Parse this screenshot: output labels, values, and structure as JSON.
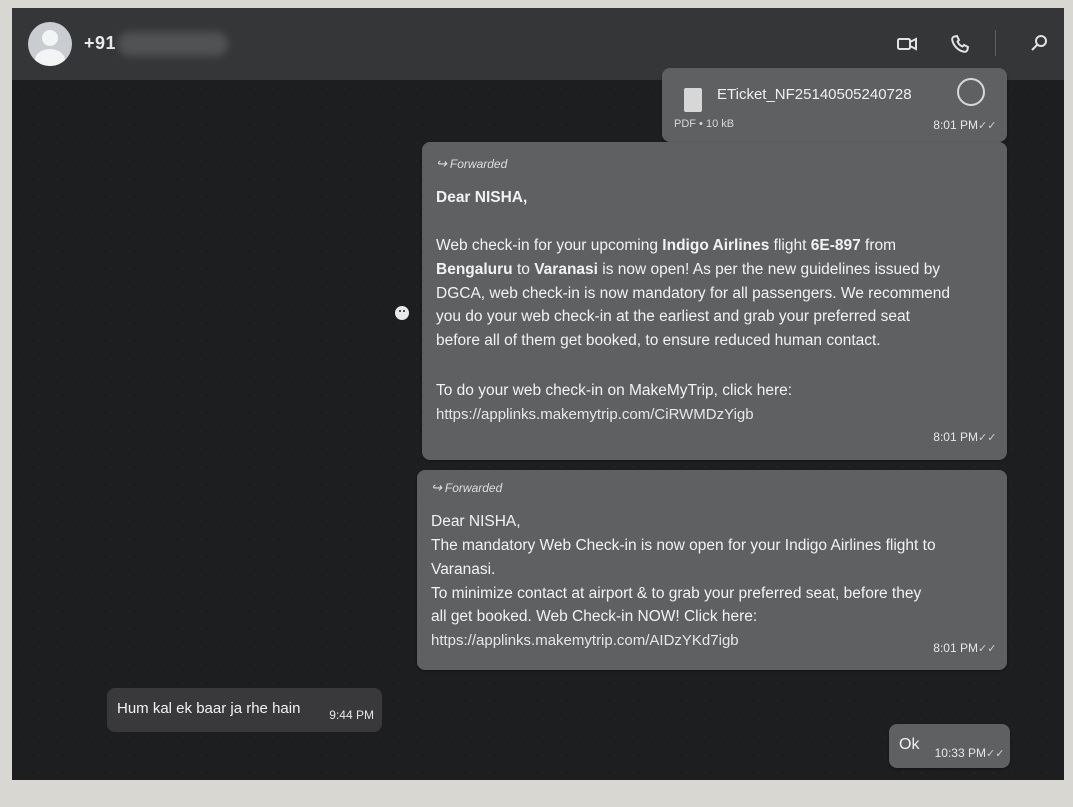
{
  "header": {
    "contact_number": "+91 ",
    "redacted_part": "blurred"
  },
  "messages": {
    "pdf": {
      "filename": "ETicket_NF25140505240728",
      "meta": "PDF • 10 kB",
      "time": "8:01 PM"
    },
    "forwarded_1": {
      "label": "Forwarded",
      "greeting": "Dear NISHA,",
      "line1": "Web check-in for your upcoming ",
      "line1_bold": "Indigo Airlines",
      "line1b": " flight ",
      "line1b_bold": "6E-897",
      "line1c": " from",
      "line2_bold": "Bengaluru",
      "line2": " to ",
      "line2_bold2": "Varanasi",
      "line2b": " is now open! As per the new guidelines issued by",
      "line3": "DGCA, web check-in is now mandatory for all passengers. We recommend",
      "line4": "you do your web check-in at the earliest and grab your preferred seat",
      "line5": "before all of them get booked, to ensure reduced human contact.",
      "line6": "To do your web check-in on MakeMyTrip, click here:",
      "link": "https://applinks.makemytrip.com/CiRWMDzYigb",
      "time": "8:01 PM"
    },
    "forwarded_2": {
      "label": "Forwarded",
      "line1": "Dear NISHA,",
      "line2": "The mandatory Web Check-in is now open for your Indigo Airlines flight to",
      "line3": "Varanasi.",
      "line4": "To minimize contact at airport & to grab your preferred seat, before they",
      "line5": "all get booked. Web Check-in NOW! Click here:",
      "link": "https://applinks.makemytrip.com/AIDzYKd7igb",
      "time": "8:01 PM"
    },
    "incoming": {
      "text": "Hum kal ek baar ja rhe hain",
      "time": "9:44 PM"
    },
    "outgoing_ok": {
      "text": "Ok",
      "time": "10:33 PM"
    }
  }
}
